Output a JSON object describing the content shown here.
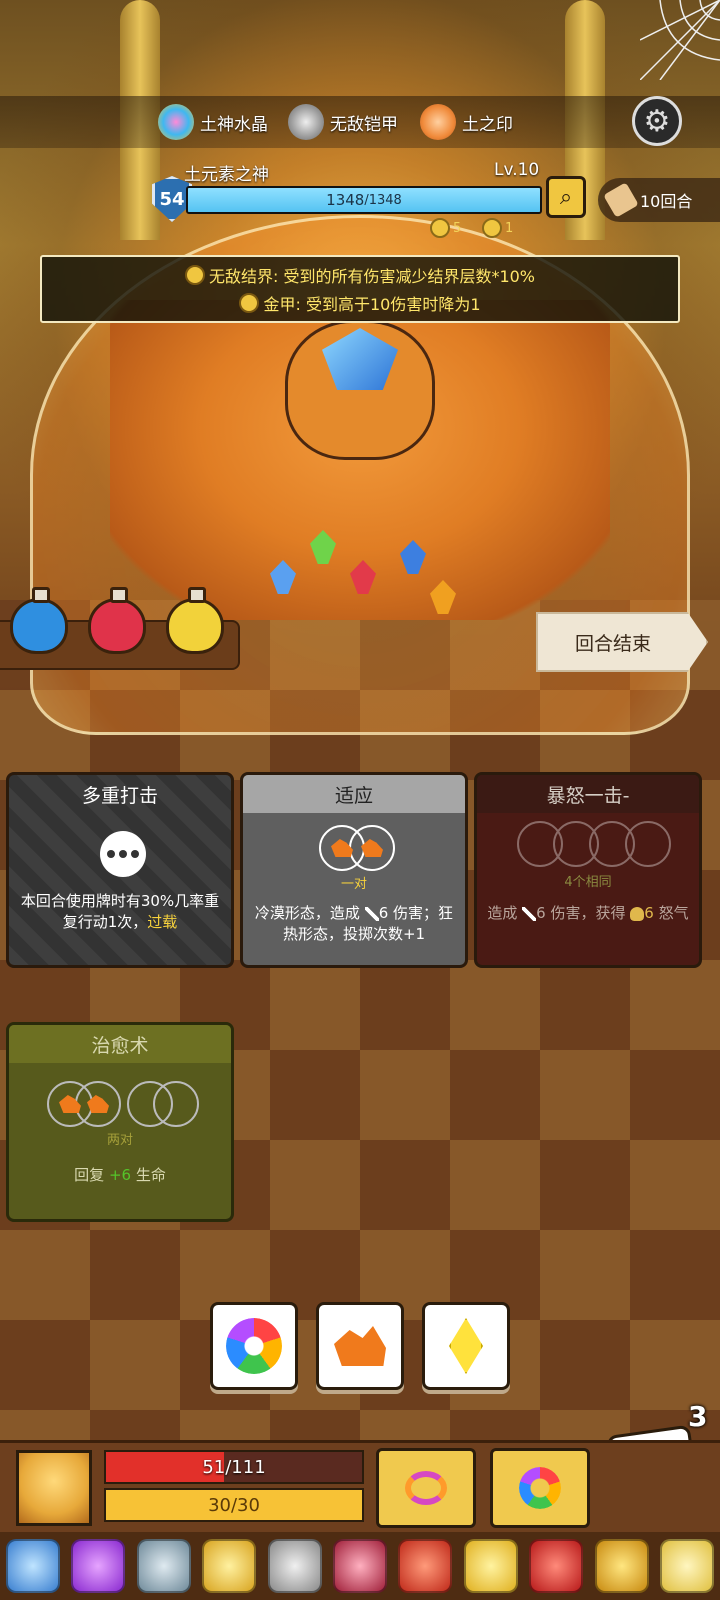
{
  "relics": [
    {
      "name": "土神水晶",
      "icon": "crystal-relic-icon"
    },
    {
      "name": "无敌铠甲",
      "icon": "armor-relic-icon"
    },
    {
      "name": "土之印",
      "icon": "earth-seal-icon"
    }
  ],
  "boss": {
    "name": "土元素之神",
    "level": "Lv.10",
    "armor": "54",
    "hp_current": "1348",
    "hp_max": "/1348",
    "hp_fraction": 1.0,
    "status_1_count": "5",
    "status_2_count": "1"
  },
  "turns": {
    "label": "10回合"
  },
  "buffs": [
    {
      "text": "无敌结界: 受到的所有伤害减少结界层数*10%"
    },
    {
      "text": "金甲: 受到高于10伤害时降为1"
    }
  ],
  "potions": [
    {
      "color": "#2f8fe0"
    },
    {
      "color": "#e0334a"
    },
    {
      "color": "#f2d23a"
    }
  ],
  "end_turn": {
    "label": "回合结束"
  },
  "cards": [
    {
      "title": "多重打击",
      "desc_main": "本回合使用牌时有30%几率重复行动1次，",
      "desc_keyword": "过载"
    },
    {
      "title": "适应",
      "requirement": "一对",
      "desc_a": "冷漠形态，造成",
      "damage": "6",
      "desc_b": "伤害；狂热形态，投掷次数+1"
    },
    {
      "title": "暴怒一击-",
      "requirement": "4个相同",
      "desc_a": "造成",
      "damage": "6",
      "desc_b": "伤害，获得",
      "rage": "6",
      "desc_c": "怒气"
    },
    {
      "title": "治愈术",
      "requirement": "两对",
      "desc_a": "回复",
      "heal": "+6",
      "desc_b": "生命"
    }
  ],
  "dice": [
    {
      "face": "rainbow-swirl"
    },
    {
      "face": "earth-rock"
    },
    {
      "face": "yellow-diamond"
    }
  ],
  "dice_remaining": "3",
  "player": {
    "hp_text": "51/111",
    "hp_fraction": 0.46,
    "energy_text": "30/30",
    "energy_fraction": 1.0
  },
  "inventory": [
    "blue-crescent-icon",
    "purple-potion-icon",
    "axe-icon",
    "golden-helmet-icon",
    "coin-icon",
    "heart-charm-icon",
    "red-cauldron-icon",
    "crown-icon",
    "red-dragon-icon",
    "golden-cross-icon",
    "banana-icon"
  ],
  "colors": {
    "hp": "#e2302a",
    "energy": "#f7c236",
    "boss_hp": "#55c3f2",
    "buff_text": "#ffe66b"
  }
}
